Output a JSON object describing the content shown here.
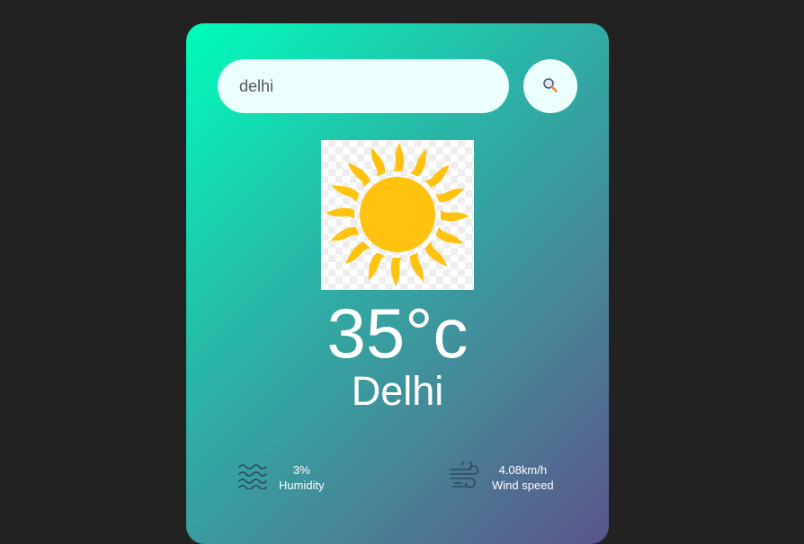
{
  "search": {
    "value": "delhi",
    "button_icon": "search-icon"
  },
  "weather": {
    "icon": "sun-icon",
    "temperature": "35°c",
    "city": "Delhi"
  },
  "details": {
    "humidity": {
      "icon": "humidity-waves-icon",
      "value": "3%",
      "label": "Humidity"
    },
    "wind": {
      "icon": "wind-icon",
      "value": "4.08km/h",
      "label": "Wind speed"
    }
  },
  "colors": {
    "page_background": "#222222",
    "card_gradient_start": "#00feba",
    "card_gradient_end": "#5b548a",
    "sun": "#ffc20e",
    "input_background": "#ebfffc"
  }
}
